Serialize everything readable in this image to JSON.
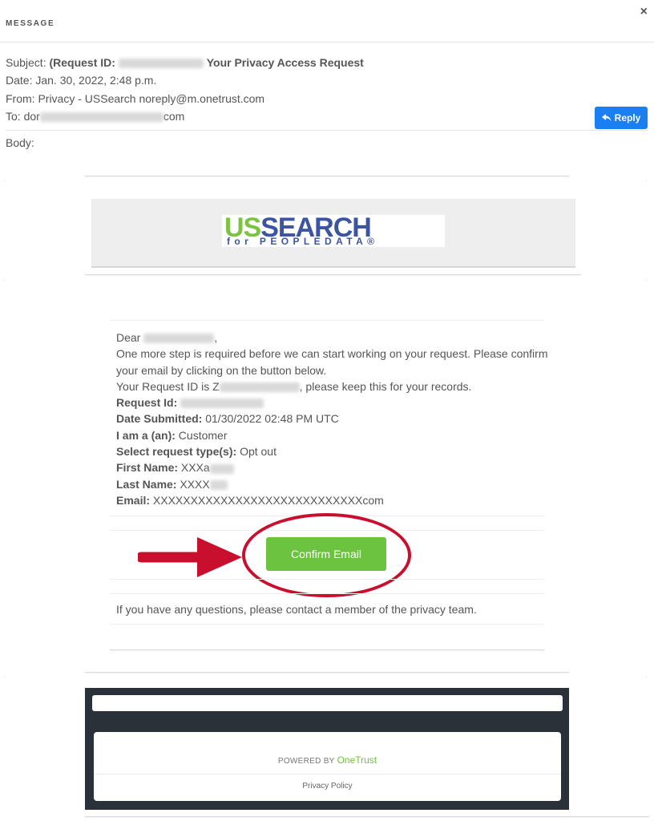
{
  "header": {
    "title": "MESSAGE",
    "close_symbol": "×"
  },
  "meta": {
    "subject_label": "Subject:",
    "subject_bold": "(Request ID:",
    "subject_rest": "Your Privacy Access Request",
    "date": "Date: Jan. 30, 2022, 2:48 p.m.",
    "from": "From: Privacy - USSearch noreply@m.onetrust.com",
    "to_prefix": "To: dor",
    "to_suffix": "com",
    "body_label": "Body:"
  },
  "reply_label": "Reply",
  "logo": {
    "us": "US",
    "search": "SEARCH",
    "sub": "for PEOPLEDATA®"
  },
  "content": {
    "dear": "Dear",
    "para1": "One more step is required before we can start working on your request. Please confirm your email by clicking on the button below.",
    "request_id_prefix": "Your Request ID is Z",
    "request_id_suffix": ", please keep this for your records.",
    "fields": {
      "request_id_label": "Request Id:",
      "date_label": "Date Submitted:",
      "date_value": "01/30/2022 02:48 PM UTC",
      "iam_label": "I am a (an):",
      "iam_value": "Customer",
      "type_label": "Select request type(s):",
      "type_value": "Opt out",
      "first_label": "First Name:",
      "first_value": "XXXa",
      "last_label": "Last Name:",
      "last_value": "XXXX",
      "email_label": "Email:",
      "email_value": "XXXXXXXXXXXXXXXXXXXXXXXXXXXXcom"
    }
  },
  "confirm_button": "Confirm Email",
  "questions": "If you have any questions, please contact a member of the privacy team.",
  "footer": {
    "powered_by": "POWERED BY",
    "onetrust": "OneTrust",
    "privacy_policy": "Privacy Policy"
  },
  "colors": {
    "reply": "#1a7ff0",
    "confirm": "#6cc33f",
    "annotation": "#c8102e",
    "footer_dark": "#2b3138"
  }
}
